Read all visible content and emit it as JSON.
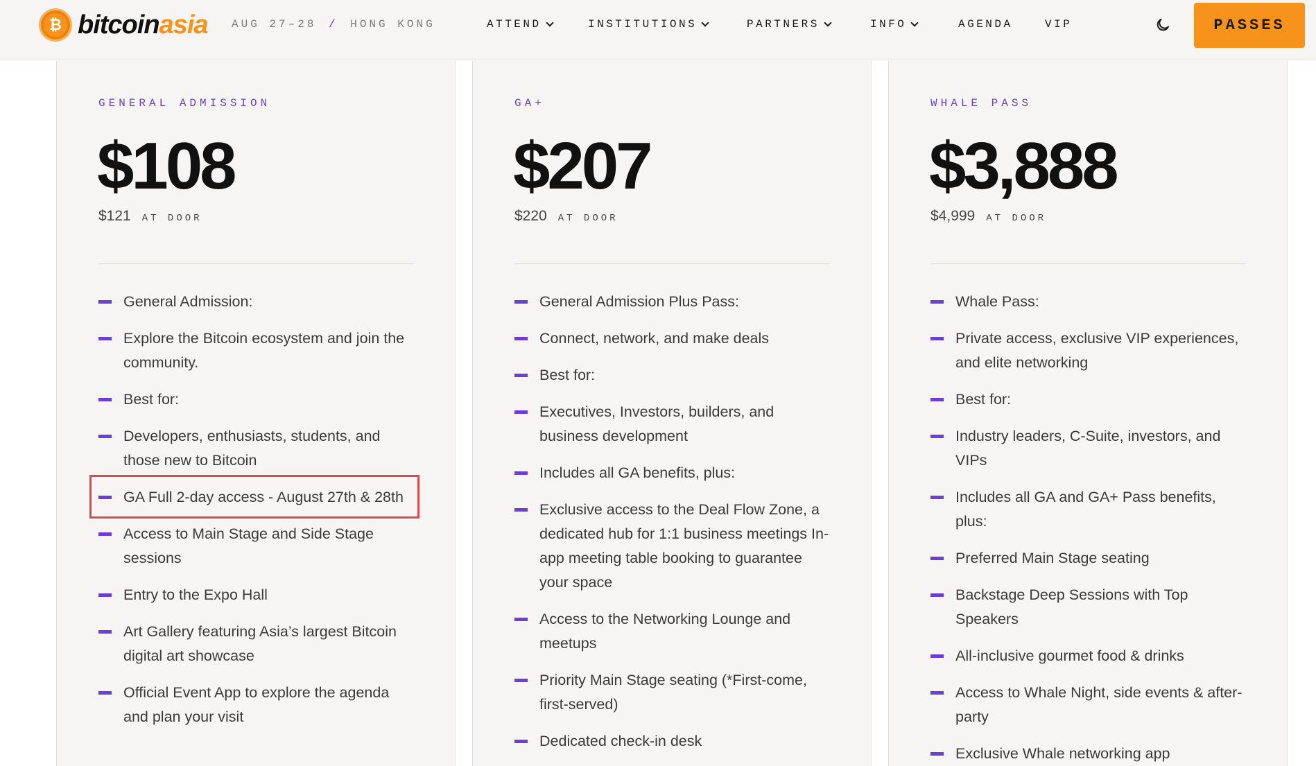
{
  "header": {
    "logo_main": "bitcoin",
    "logo_accent": "asia",
    "coin_symbol": "₿",
    "event_dates": "AUG 27–28",
    "event_city": "HONG KONG",
    "nav": [
      {
        "label": "ATTEND",
        "dropdown": true
      },
      {
        "label": "INSTITUTIONS",
        "dropdown": true
      },
      {
        "label": "PARTNERS",
        "dropdown": true
      },
      {
        "label": "INFO",
        "dropdown": true
      },
      {
        "label": "AGENDA",
        "dropdown": false
      },
      {
        "label": "VIP",
        "dropdown": false
      }
    ],
    "theme_icon": "moon-icon",
    "passes_label": "PASSES"
  },
  "colors": {
    "accent": "#f7931a",
    "purple": "#6b3fd4",
    "highlight": "#e0464f"
  },
  "cards": [
    {
      "tier": "GENERAL ADMISSION",
      "price": "$108",
      "door_price": "$121",
      "door_label": "AT DOOR",
      "features": [
        "General Admission:",
        "Explore the Bitcoin ecosystem and join the community.",
        "Best for:",
        "Developers, enthusiasts, students, and those new to Bitcoin",
        "GA Full 2-day access - August 27th & 28th",
        "Access to Main Stage and Side Stage sessions",
        "Entry to the Expo Hall",
        "Art Gallery featuring Asia’s largest Bitcoin digital art showcase",
        "Official Event App to explore the agenda and plan your visit"
      ]
    },
    {
      "tier": "GA+",
      "price": "$207",
      "door_price": "$220",
      "door_label": "AT DOOR",
      "features": [
        "General Admission Plus Pass:",
        "Connect, network, and make deals",
        "Best for:",
        "Executives, Investors, builders, and business development",
        "Includes all GA benefits, plus:",
        "Exclusive access to the Deal Flow Zone, a dedicated hub for 1:1 business meetings In-app meeting table booking to guarantee your space",
        "Access to the Networking Lounge and meetups",
        "Priority Main Stage seating (*First-come, first-served)",
        "Dedicated check-in desk"
      ]
    },
    {
      "tier": "WHALE PASS",
      "price": "$3,888",
      "door_price": "$4,999",
      "door_label": "AT DOOR",
      "features": [
        "Whale Pass:",
        "Private access, exclusive VIP experiences, and elite networking",
        "Best for:",
        "Industry leaders, C-Suite, investors, and VIPs",
        "Includes all GA and GA+ Pass benefits, plus:",
        "Preferred Main Stage seating",
        "Backstage Deep Sessions with Top Speakers",
        "All-inclusive gourmet food & drinks",
        "Access to Whale Night, side events & after-party",
        "Exclusive Whale networking app"
      ]
    }
  ]
}
